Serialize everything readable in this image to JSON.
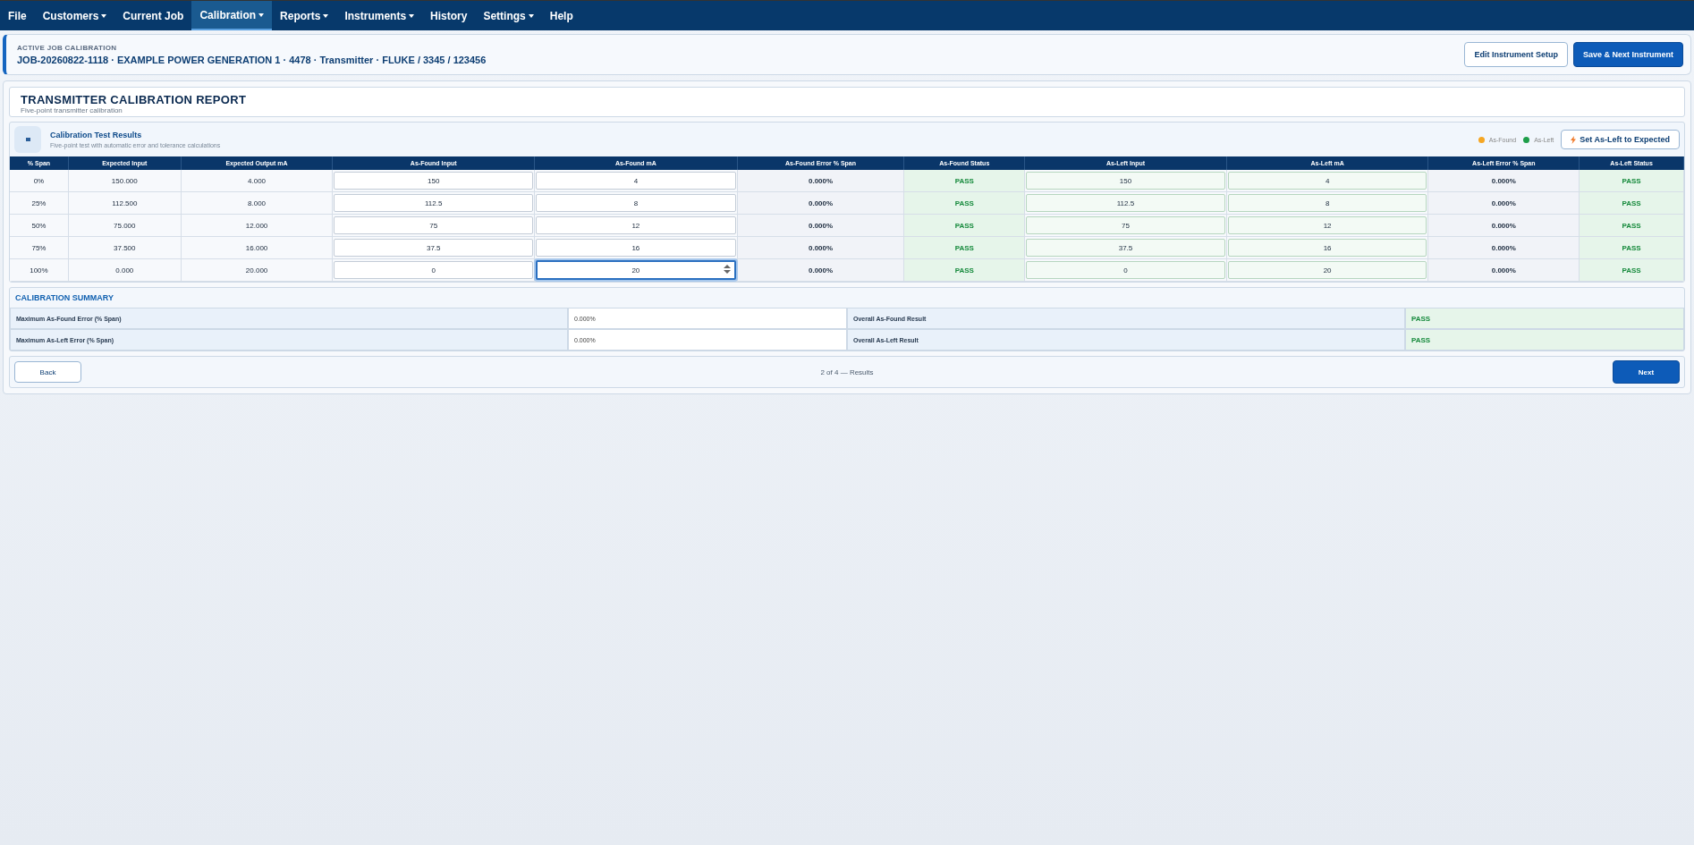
{
  "menu": [
    {
      "label": "File",
      "dropdown": false,
      "selected": false
    },
    {
      "label": "Customers",
      "dropdown": true,
      "selected": false
    },
    {
      "label": "Current Job",
      "dropdown": false,
      "selected": false
    },
    {
      "label": "Calibration",
      "dropdown": true,
      "selected": true
    },
    {
      "label": "Reports",
      "dropdown": true,
      "selected": false
    },
    {
      "label": "Instruments",
      "dropdown": true,
      "selected": false
    },
    {
      "label": "History",
      "dropdown": false,
      "selected": false
    },
    {
      "label": "Settings",
      "dropdown": true,
      "selected": false
    },
    {
      "label": "Help",
      "dropdown": false,
      "selected": false
    }
  ],
  "job": {
    "eyebrow": "ACTIVE JOB CALIBRATION",
    "title": "JOB-20260822-1118 · EXAMPLE POWER GENERATION 1 · 4478 · Transmitter · FLUKE / 3345 / 123456",
    "buttons": [
      {
        "label": "Edit Instrument Setup",
        "kind": "secondary"
      },
      {
        "label": "Save & Next Instrument",
        "kind": "primary"
      }
    ]
  },
  "report": {
    "title": "TRANSMITTER CALIBRATION REPORT",
    "subtitle": "Five-point transmitter calibration"
  },
  "results": {
    "title": "Calibration Test Results",
    "subtitle": "Five-point test with automatic error and tolerance calculations",
    "legend": [
      {
        "label": "As-Found",
        "color": "#f5a623"
      },
      {
        "label": "As-Left",
        "color": "#1e9e4a"
      }
    ],
    "action": "Set As-Left to Expected",
    "columns": [
      "% Span",
      "Expected Input",
      "Expected Output mA",
      "As-Found Input",
      "As-Found mA",
      "As-Found Error % Span",
      "As-Found Status",
      "As-Left Input",
      "As-Left mA",
      "As-Left Error % Span",
      "As-Left Status"
    ],
    "rows": [
      {
        "span": "0%",
        "expected_input": "150.000",
        "expected_output": "4.000",
        "as_found_input": "150",
        "as_found_ma": "4",
        "as_found_ma_focused": false,
        "as_found_error": "0.000%",
        "as_found_status": {
          "text": "PASS",
          "passed": true
        },
        "as_left_input": "150",
        "as_left_ma": "4",
        "as_left_error": "0.000%",
        "as_left_status": {
          "text": "PASS",
          "passed": true
        }
      },
      {
        "span": "25%",
        "expected_input": "112.500",
        "expected_output": "8.000",
        "as_found_input": "112.5",
        "as_found_ma": "8",
        "as_found_ma_focused": false,
        "as_found_error": "0.000%",
        "as_found_status": {
          "text": "PASS",
          "passed": true
        },
        "as_left_input": "112.5",
        "as_left_ma": "8",
        "as_left_error": "0.000%",
        "as_left_status": {
          "text": "PASS",
          "passed": true
        }
      },
      {
        "span": "50%",
        "expected_input": "75.000",
        "expected_output": "12.000",
        "as_found_input": "75",
        "as_found_ma": "12",
        "as_found_ma_focused": false,
        "as_found_error": "0.000%",
        "as_found_status": {
          "text": "PASS",
          "passed": true
        },
        "as_left_input": "75",
        "as_left_ma": "12",
        "as_left_error": "0.000%",
        "as_left_status": {
          "text": "PASS",
          "passed": true
        }
      },
      {
        "span": "75%",
        "expected_input": "37.500",
        "expected_output": "16.000",
        "as_found_input": "37.5",
        "as_found_ma": "16",
        "as_found_ma_focused": false,
        "as_found_error": "0.000%",
        "as_found_status": {
          "text": "PASS",
          "passed": true
        },
        "as_left_input": "37.5",
        "as_left_ma": "16",
        "as_left_error": "0.000%",
        "as_left_status": {
          "text": "PASS",
          "passed": true
        }
      },
      {
        "span": "100%",
        "expected_input": "0.000",
        "expected_output": "20.000",
        "as_found_input": "0",
        "as_found_ma": "20",
        "as_found_ma_focused": true,
        "as_found_error": "0.000%",
        "as_found_status": {
          "text": "PASS",
          "passed": true
        },
        "as_left_input": "0",
        "as_left_ma": "20",
        "as_left_error": "0.000%",
        "as_left_status": {
          "text": "PASS",
          "passed": true
        }
      }
    ]
  },
  "summary": {
    "title": "CALIBRATION SUMMARY",
    "rows": [
      {
        "label": "Maximum As-Found Error (% Span)",
        "value": "0.000%",
        "result_label": "Overall As-Found Result",
        "result": {
          "text": "PASS",
          "passed": true
        }
      },
      {
        "label": "Maximum As-Left Error (% Span)",
        "value": "0.000%",
        "result_label": "Overall As-Left Result",
        "result": {
          "text": "PASS",
          "passed": true
        }
      }
    ]
  },
  "footer": {
    "back": "Back",
    "step": "2 of 4 — Results",
    "next": "Next"
  }
}
